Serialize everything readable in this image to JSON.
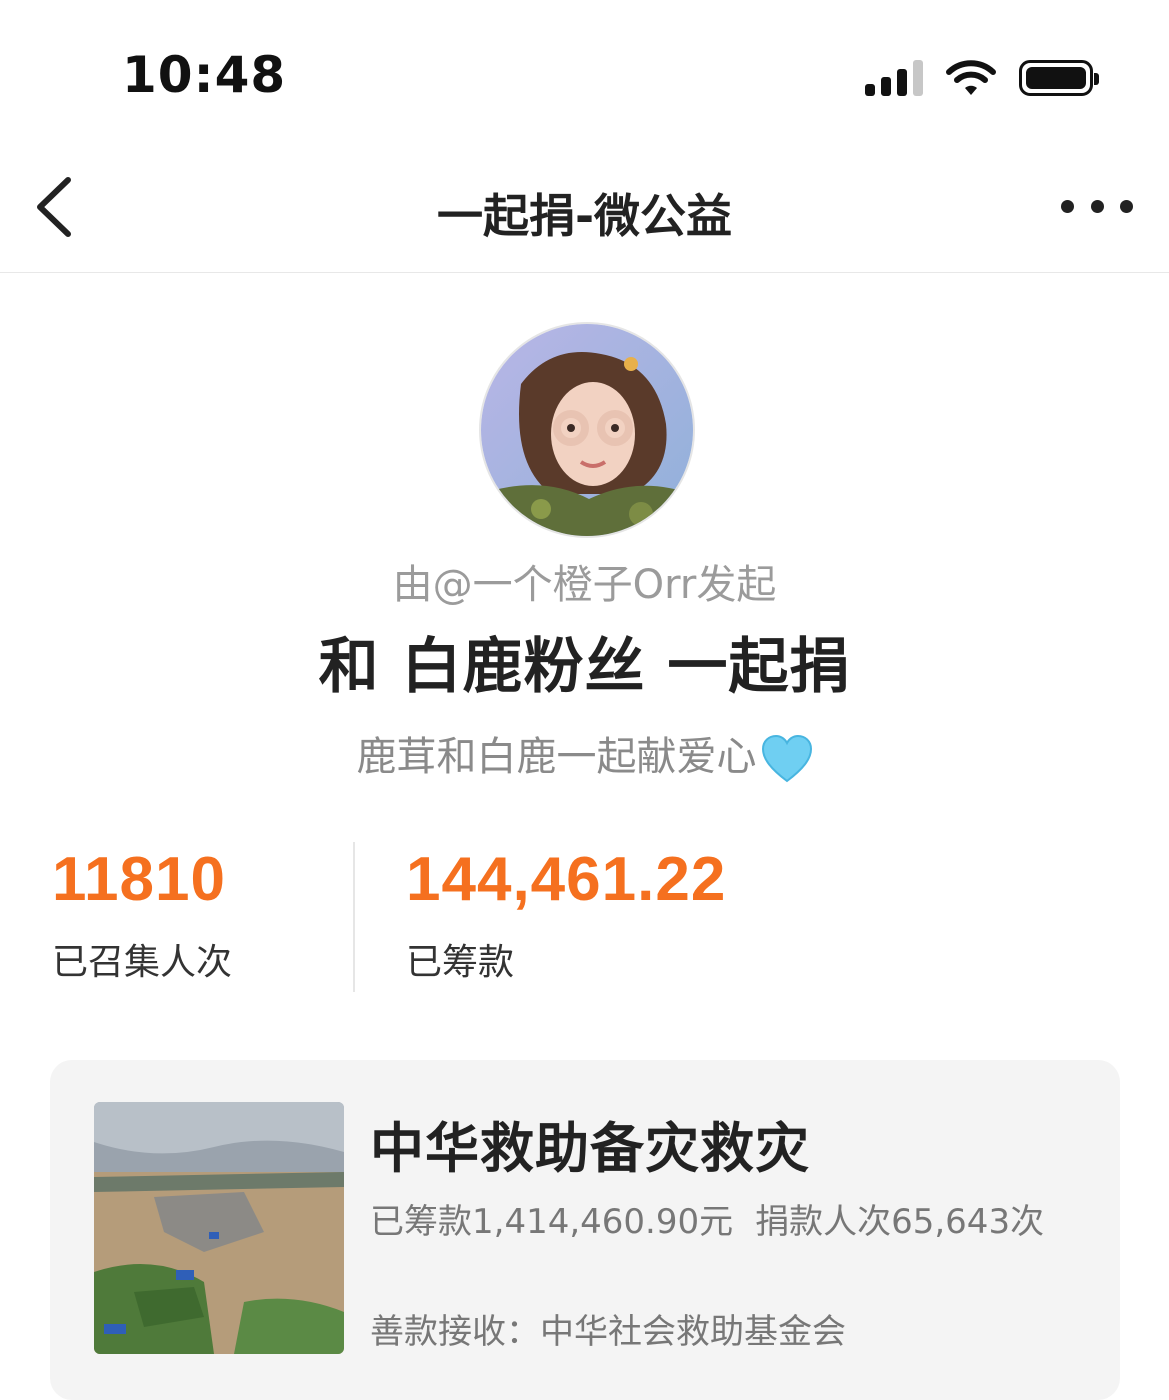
{
  "status_bar": {
    "time": "10:48",
    "icons": [
      "signal-icon",
      "wifi-icon",
      "battery-icon"
    ]
  },
  "nav": {
    "title": "一起捐-微公益",
    "back_icon": "chevron-left-icon",
    "more_icon": "more-dots-icon"
  },
  "campaign": {
    "initiator": "由@一个橙子Orr发起",
    "headline": "和 白鹿粉丝 一起捐",
    "subline": "鹿茸和白鹿一起献爱心",
    "subline_emoji": "light-blue-heart-icon"
  },
  "stats": {
    "participants_value": "11810",
    "participants_label": "已召集人次",
    "raised_value": "144,461.22",
    "raised_label": "已筹款"
  },
  "project": {
    "title": "中华救助备灾救灾",
    "raised_text": "已筹款1,414,460.90元",
    "donors_text": "捐款人次65,643次",
    "recipient_text": "善款接收：中华社会救助基金会"
  },
  "colors": {
    "accent": "#f5701f",
    "text_primary": "#222222",
    "text_secondary": "#9b9b9b",
    "card_bg": "#f4f4f4"
  }
}
